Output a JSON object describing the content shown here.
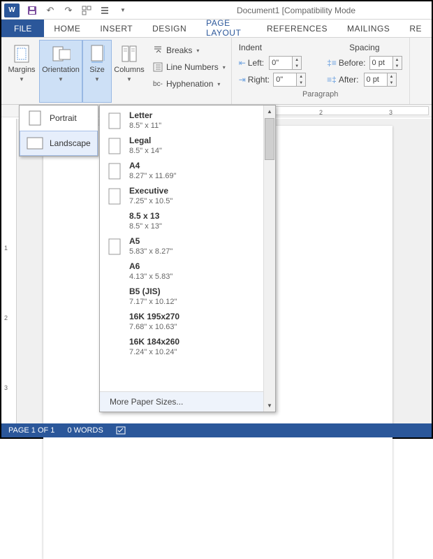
{
  "title": "Document1  [Compatibility Mode",
  "qat": {
    "save": "💾",
    "undo": "↶",
    "redo": "↷"
  },
  "tabs": {
    "file": "FILE",
    "items": [
      "HOME",
      "INSERT",
      "DESIGN",
      "PAGE LAYOUT",
      "REFERENCES",
      "MAILINGS",
      "RE"
    ],
    "active_index": 3
  },
  "page_setup": {
    "margins": "Margins",
    "orientation": "Orientation",
    "size": "Size",
    "columns": "Columns",
    "breaks": "Breaks",
    "line_numbers": "Line Numbers",
    "hyphenation": "Hyphenation"
  },
  "indent": {
    "title": "Indent",
    "left_label": "Left:",
    "right_label": "Right:",
    "left_value": "0\"",
    "right_value": "0\""
  },
  "spacing": {
    "title": "Spacing",
    "before_label": "Before:",
    "after_label": "After:",
    "before_value": "0 pt",
    "after_value": "0 pt"
  },
  "paragraph_label": "Paragraph",
  "ruler_marks": [
    "2",
    "3"
  ],
  "orientation_menu": {
    "portrait": "Portrait",
    "landscape": "Landscape"
  },
  "size_menu": {
    "items": [
      {
        "name": "Letter",
        "dim": "8.5\" x 11\"",
        "icon": true
      },
      {
        "name": "Legal",
        "dim": "8.5\" x 14\"",
        "icon": true
      },
      {
        "name": "A4",
        "dim": "8.27\" x 11.69\"",
        "icon": true
      },
      {
        "name": "Executive",
        "dim": "7.25\" x 10.5\"",
        "icon": true
      },
      {
        "name": "8.5 x 13",
        "dim": "8.5\" x 13\"",
        "icon": false
      },
      {
        "name": "A5",
        "dim": "5.83\" x 8.27\"",
        "icon": true
      },
      {
        "name": "A6",
        "dim": "4.13\" x 5.83\"",
        "icon": false
      },
      {
        "name": "B5 (JIS)",
        "dim": "7.17\" x 10.12\"",
        "icon": false
      },
      {
        "name": "16K 195x270",
        "dim": "7.68\" x 10.63\"",
        "icon": false
      },
      {
        "name": "16K 184x260",
        "dim": "7.24\" x 10.24\"",
        "icon": false
      }
    ],
    "more": "More Paper Sizes..."
  },
  "status": {
    "page": "PAGE 1 OF 1",
    "words": "0 WORDS"
  }
}
